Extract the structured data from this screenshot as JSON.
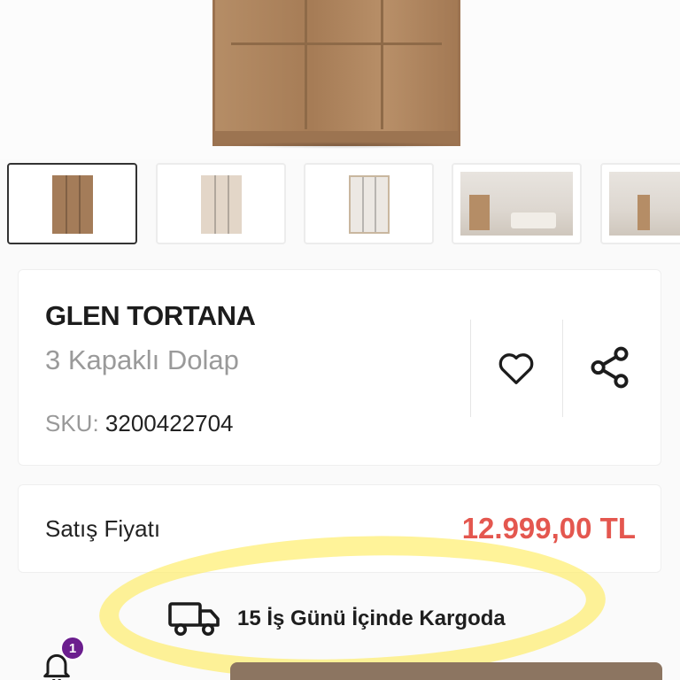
{
  "product": {
    "brand": "GLEN TORTANA",
    "subtitle": "3 Kapaklı Dolap",
    "sku_label": "SKU:",
    "sku_value": "3200422704"
  },
  "gallery": {
    "thumbnails": [
      {
        "kind": "wardrobe",
        "color": "#a47c59",
        "active": true
      },
      {
        "kind": "wardrobe",
        "color": "#e3d6c8",
        "active": false
      },
      {
        "kind": "wardrobe-open",
        "color": "#ece8e3",
        "active": false
      },
      {
        "kind": "room",
        "color": "#d9d2c9",
        "active": false
      },
      {
        "kind": "room",
        "color": "#d9d2c9",
        "active": false
      }
    ]
  },
  "actions": {
    "favorite_icon": "heart-icon",
    "share_icon": "share-icon"
  },
  "pricing": {
    "label": "Satış Fiyatı",
    "price": "12.999,00 TL",
    "price_color": "#e4574f"
  },
  "shipping": {
    "icon": "truck-icon",
    "text": "15 İş Günü İçinde Kargoda"
  },
  "notifications": {
    "icon": "bell-icon",
    "count": "1",
    "badge_color": "#6b1e8e"
  },
  "colors": {
    "accent": "#8c7561",
    "highlight": "#ffec5a"
  }
}
